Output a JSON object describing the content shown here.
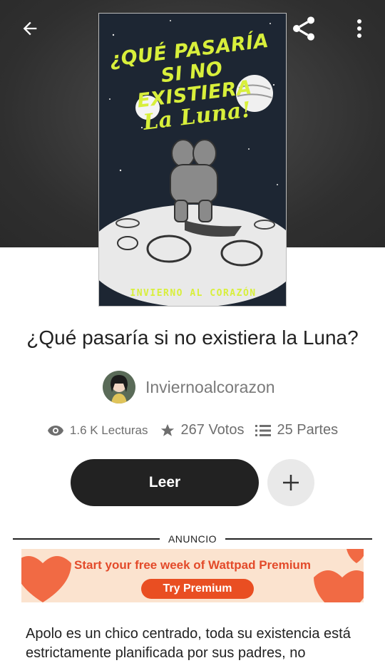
{
  "header": {
    "back_icon": "arrow-left-icon",
    "share_icon": "share-icon",
    "more_icon": "more-vertical-icon"
  },
  "cover": {
    "title_line1": "¿QUÉ PASARÍA",
    "title_line2": "SI NO",
    "title_line3": "EXISTIERA",
    "title_line4": "La Luna!",
    "author": "INVIERNO AL CORAZÓN"
  },
  "story": {
    "title": "¿Qué pasaría si no existiera la Luna?",
    "author": "Inviernoalcorazon"
  },
  "stats": {
    "reads": "1.6 K Lecturas",
    "votes": "267 Votos",
    "parts": "25 Partes",
    "reads_icon": "eye-icon",
    "votes_icon": "star-icon",
    "parts_icon": "list-icon"
  },
  "actions": {
    "read_label": "Leer",
    "add_icon": "plus-icon"
  },
  "ad": {
    "label": "ANUNCIO",
    "headline": "Start your free week of Wattpad Premium",
    "button": "Try Premium"
  },
  "description": {
    "text": "Apolo es un chico centrado, toda su existencia está estrictamente planificada por sus padres, no"
  },
  "colors": {
    "accent_dark": "#222222",
    "cover_text": "#d8ef3b",
    "ad_orange": "#e94e22",
    "ad_bg": "#fbe3cf"
  }
}
